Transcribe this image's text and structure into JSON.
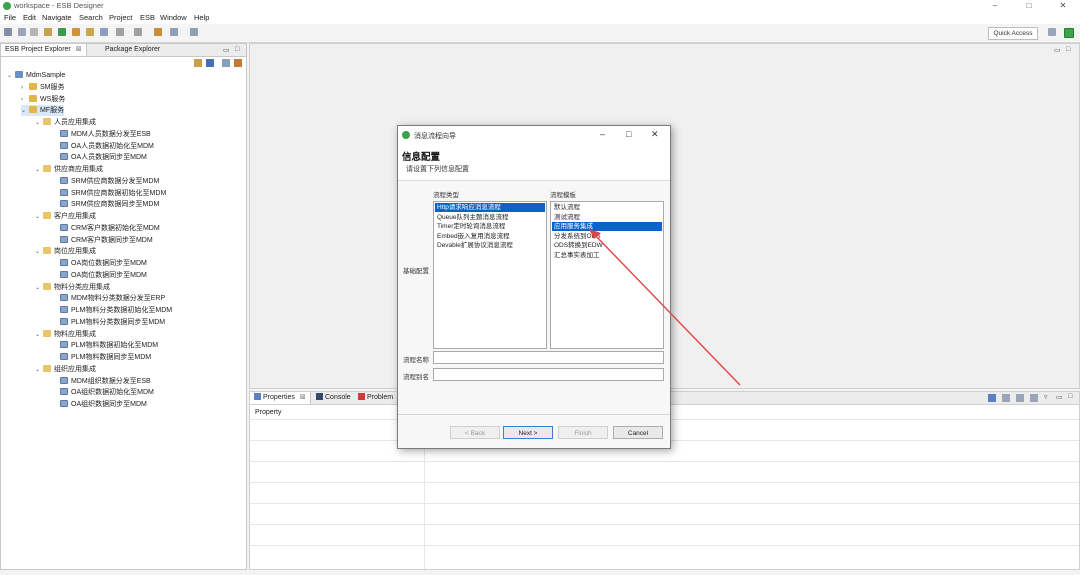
{
  "window": {
    "title": "workspace - ESB Designer",
    "minimize": "–",
    "maximize": "□",
    "close": "✕"
  },
  "menubar": [
    "File",
    "Edit",
    "Navigate",
    "Search",
    "Project",
    "ESB",
    "Window",
    "Help"
  ],
  "toolbar": {
    "quick_access": "Quick Access"
  },
  "explorer": {
    "tabs": [
      "ESB Project Explorer",
      "Package Explorer"
    ],
    "tab_close": "⊠",
    "tree": [
      {
        "label": "MdmSample",
        "level": 0,
        "expanded": true,
        "kind": "project"
      },
      {
        "label": "SM服务",
        "level": 1,
        "expanded": false,
        "kind": "package"
      },
      {
        "label": "WS服务",
        "level": 1,
        "expanded": false,
        "kind": "package"
      },
      {
        "label": "MF服务",
        "level": 1,
        "expanded": true,
        "kind": "package",
        "selected": true
      },
      {
        "label": "人员应用集成",
        "level": 2,
        "expanded": true,
        "kind": "folder"
      },
      {
        "label": "MDM人员数据分发至ESB",
        "level": 3,
        "kind": "flow"
      },
      {
        "label": "OA人员数据初始化至MDM",
        "level": 3,
        "kind": "flow"
      },
      {
        "label": "OA人员数据同步至MDM",
        "level": 3,
        "kind": "flow"
      },
      {
        "label": "供应商应用集成",
        "level": 2,
        "expanded": true,
        "kind": "folder"
      },
      {
        "label": "SRM供应商数据分发至MDM",
        "level": 3,
        "kind": "flow"
      },
      {
        "label": "SRM供应商数据初始化至MDM",
        "level": 3,
        "kind": "flow"
      },
      {
        "label": "SRM供应商数据同步至MDM",
        "level": 3,
        "kind": "flow"
      },
      {
        "label": "客户应用集成",
        "level": 2,
        "expanded": true,
        "kind": "folder"
      },
      {
        "label": "CRM客户数据初始化至MDM",
        "level": 3,
        "kind": "flow"
      },
      {
        "label": "CRM客户数据同步至MDM",
        "level": 3,
        "kind": "flow"
      },
      {
        "label": "岗位应用集成",
        "level": 2,
        "expanded": true,
        "kind": "folder"
      },
      {
        "label": "OA岗位数据同步至MDM",
        "level": 3,
        "kind": "flow"
      },
      {
        "label": "OA岗位数据同步至MDM",
        "level": 3,
        "kind": "flow"
      },
      {
        "label": "物料分类应用集成",
        "level": 2,
        "expanded": true,
        "kind": "folder"
      },
      {
        "label": "MDM物料分类数据分发至ERP",
        "level": 3,
        "kind": "flow"
      },
      {
        "label": "PLM物料分类数据初始化至MDM",
        "level": 3,
        "kind": "flow"
      },
      {
        "label": "PLM物料分类数据同步至MDM",
        "level": 3,
        "kind": "flow"
      },
      {
        "label": "物料应用集成",
        "level": 2,
        "expanded": true,
        "kind": "folder"
      },
      {
        "label": "PLM物料数据初始化至MDM",
        "level": 3,
        "kind": "flow"
      },
      {
        "label": "PLM物料数据同步至MDM",
        "level": 3,
        "kind": "flow"
      },
      {
        "label": "组织应用集成",
        "level": 2,
        "expanded": true,
        "kind": "folder"
      },
      {
        "label": "MDM组织数据分发至ESB",
        "level": 3,
        "kind": "flow"
      },
      {
        "label": "OA组织数据初始化至MDM",
        "level": 3,
        "kind": "flow"
      },
      {
        "label": "OA组织数据同步至MDM",
        "level": 3,
        "kind": "flow"
      }
    ]
  },
  "bottom": {
    "tabs": [
      "Properties",
      "Console",
      "Problem"
    ],
    "column_header": "Property"
  },
  "dialog": {
    "title": "消息流程向导",
    "header_title": "信息配置",
    "header_subtitle": "请设置下列信息配置",
    "group_label": "基础配置",
    "flow_type_label": "流程类型",
    "flow_template_label": "流程模板",
    "flow_types": [
      {
        "label": "Http请求响应消息流程",
        "selected": true
      },
      {
        "label": "Queue队列主题消息流程"
      },
      {
        "label": "Timer定时轮询消息流程"
      },
      {
        "label": "Embed嵌入复用消息流程"
      },
      {
        "label": "Devable扩展协议消息流程"
      }
    ],
    "flow_templates": [
      {
        "label": "默认流程"
      },
      {
        "label": "测试流程"
      },
      {
        "label": "应用服务集成",
        "selected": true
      },
      {
        "label": "分发系统到ODS"
      },
      {
        "label": "ODS转换到EDW"
      },
      {
        "label": "汇总事实表加工"
      }
    ],
    "name_label": "流程名称",
    "alias_label": "流程别名",
    "name_value": "",
    "alias_value": "",
    "buttons": {
      "back": "< Back",
      "next": "Next >",
      "finish": "Finish",
      "cancel": "Cancel"
    }
  },
  "colors": {
    "annotation_arrow": "#e04545",
    "selection": "#0a64c8"
  }
}
